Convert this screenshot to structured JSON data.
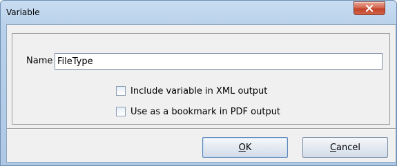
{
  "window": {
    "title": "Variable",
    "close_icon": "close-icon"
  },
  "form": {
    "name_label": "Name",
    "name_value": "FileType",
    "checkboxes": [
      {
        "label": "Include variable in XML output",
        "checked": false
      },
      {
        "label": "Use as a bookmark in PDF output",
        "checked": false
      }
    ]
  },
  "buttons": {
    "ok": {
      "mnemonic": "O",
      "rest": "K"
    },
    "cancel": {
      "mnemonic": "C",
      "rest": "ancel"
    }
  },
  "colors": {
    "titlebar": "#b9d1ea",
    "close_button": "#c2422a",
    "client_background": "#f0f0f0",
    "default_button_border": "#5c86b8"
  }
}
